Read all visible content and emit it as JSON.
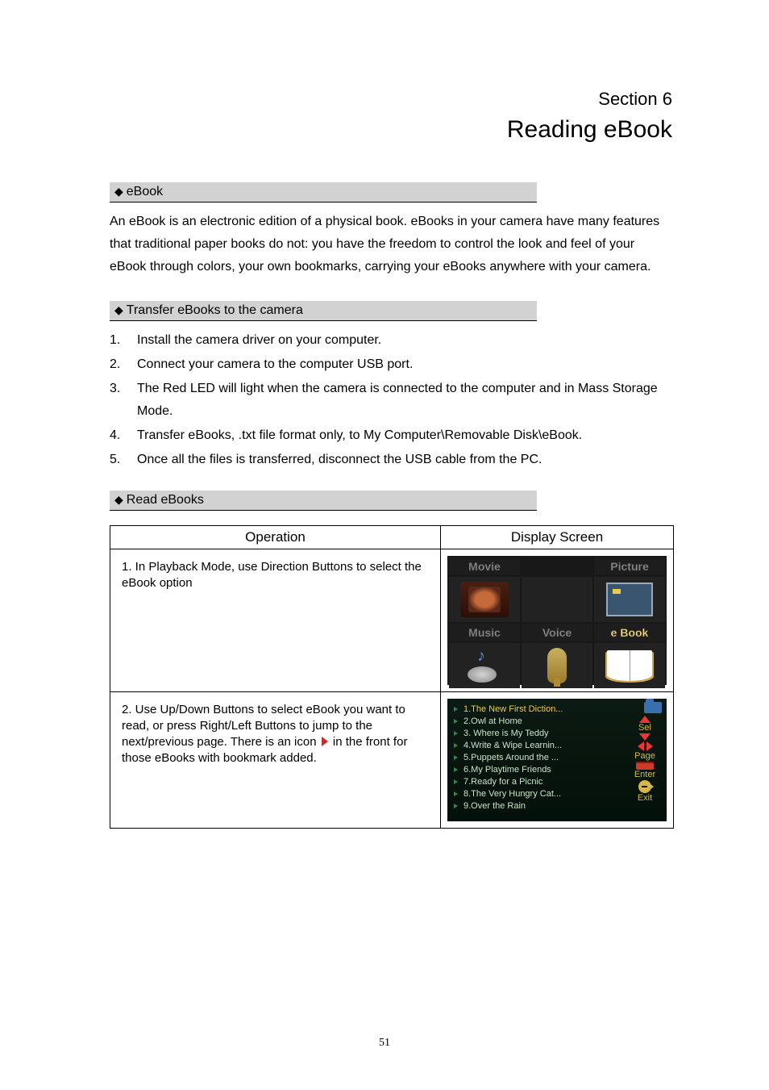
{
  "section_number": "Section 6",
  "section_title": "Reading eBook",
  "sub1": {
    "title": "eBook"
  },
  "intro": "An eBook is an electronic edition of a physical book. eBooks in your camera have many features that traditional paper books do not: you have the freedom to control the look and feel of your eBook through colors, your own bookmarks, carrying your eBooks anywhere with your camera.",
  "sub2": {
    "title": "Transfer eBooks to the camera"
  },
  "steps": [
    "Install the camera driver on your computer.",
    "Connect your camera to the computer USB port.",
    "The Red LED will light when the camera is connected to the computer and in Mass Storage Mode.",
    "Transfer eBooks, .txt file format only, to My Computer\\Removable Disk\\eBook.",
    "Once all the files is transferred, disconnect the USB cable from the PC."
  ],
  "sub3": {
    "title": "Read eBooks"
  },
  "table": {
    "col1": "Operation",
    "col2": "Display Screen",
    "row1_op": "1. In Playback Mode, use Direction Buttons to select the eBook option",
    "row2_op_a": "2. Use Up/Down Buttons to select eBook you want to read, or press Right/Left Buttons to jump to the next/previous page.    There is an icon",
    "row2_op_b": "in the front for those eBooks with bookmark added."
  },
  "menu": {
    "movie": "Movie",
    "picture": "Picture",
    "music": "Music",
    "voice": "Voice",
    "ebook": "e Book"
  },
  "ebook_list": {
    "items": [
      "1.The New First Diction...",
      "2.Owl at Home",
      "3. Where is My Teddy",
      "4.Write & Wipe Learnin...",
      "5.Puppets Around the ...",
      "6.My Playtime Friends",
      "7.Ready for a Picnic",
      "8.The Very Hungry Cat...",
      "9.Over the  Rain"
    ],
    "side": {
      "sel": "Sel",
      "page": "Page",
      "enter": "Enter",
      "exit": "Exit"
    }
  },
  "page_number": "51"
}
